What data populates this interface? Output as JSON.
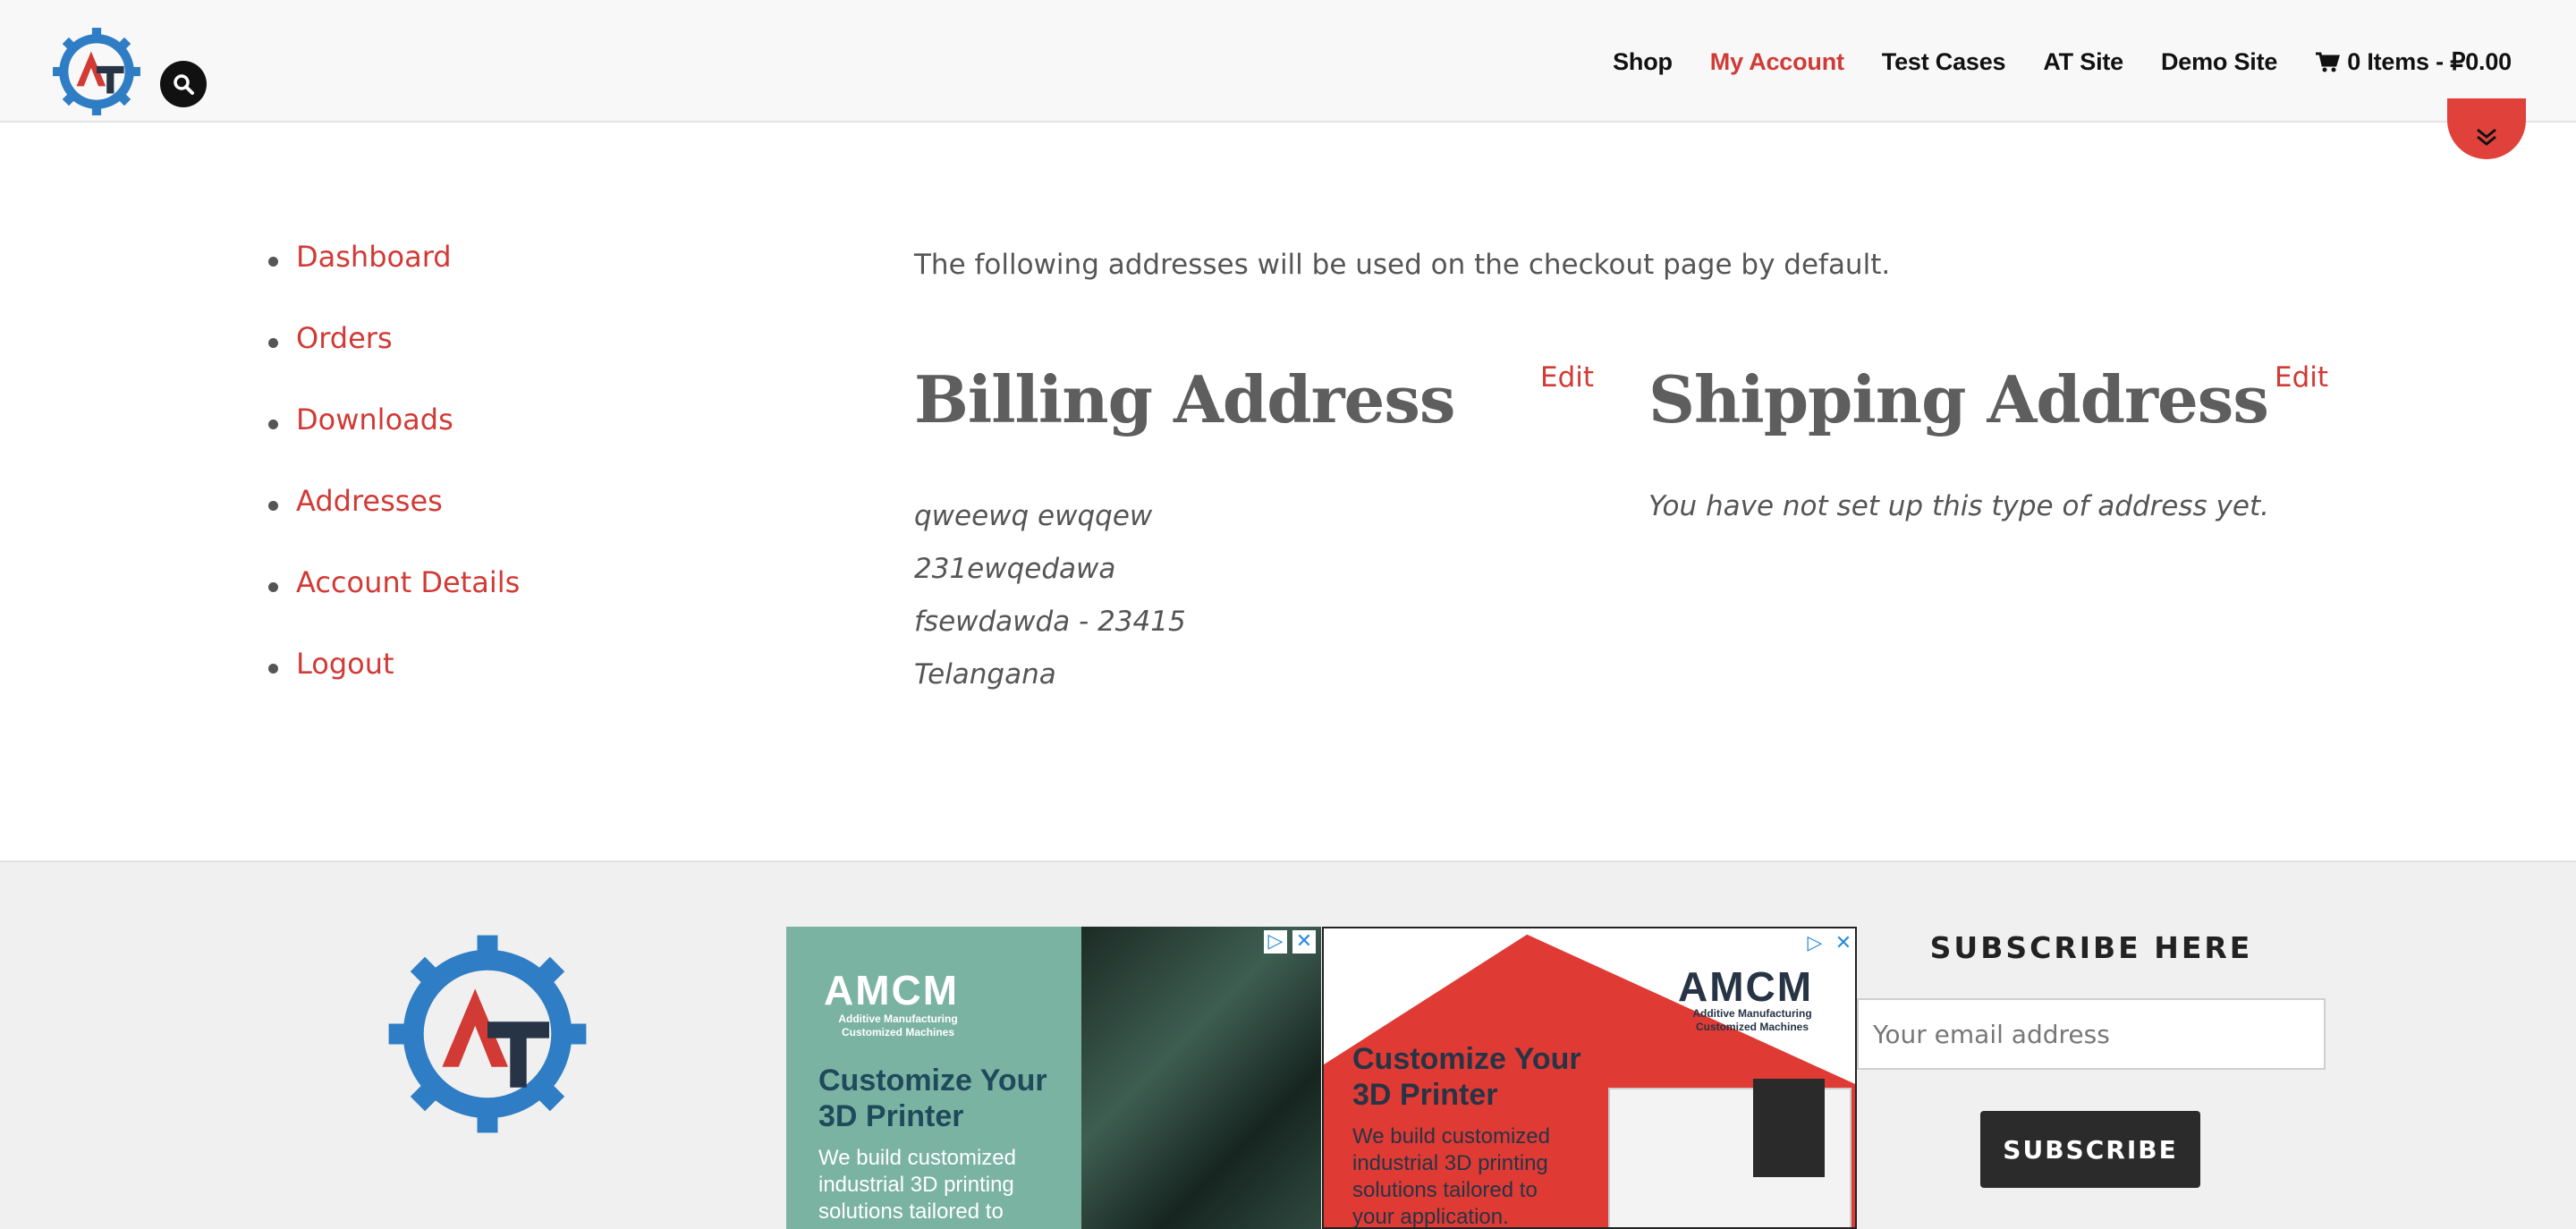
{
  "header": {
    "nav": [
      {
        "label": "Shop"
      },
      {
        "label": "My Account",
        "active": true
      },
      {
        "label": "Test Cases"
      },
      {
        "label": "AT Site"
      },
      {
        "label": "Demo Site"
      }
    ],
    "cart_label": "0 Items - ₽0.00",
    "logo_letters": "AT"
  },
  "sidebar": {
    "items": [
      {
        "label": "Dashboard"
      },
      {
        "label": "Orders"
      },
      {
        "label": "Downloads"
      },
      {
        "label": "Addresses"
      },
      {
        "label": "Account Details"
      },
      {
        "label": "Logout"
      }
    ]
  },
  "main": {
    "intro": "The following addresses will be used on the checkout page by default.",
    "billing": {
      "title": "Billing Address",
      "edit_label": "Edit",
      "lines": [
        "qweewq ewqqew",
        "231ewqedawa",
        "fsewdawda - 23415",
        "Telangana"
      ]
    },
    "shipping": {
      "title": "Shipping Address",
      "edit_label": "Edit",
      "empty_text": "You have not set up this type of address yet."
    }
  },
  "footer": {
    "ads": [
      {
        "brand": "AMCM",
        "subtitle": "Additive Manufacturing\nCustomized Machines",
        "headline": "Customize Your\n3D Printer",
        "body": "We build customized\nindustrial 3D printing\nsolutions tailored to"
      },
      {
        "brand": "AMCM",
        "subtitle": "Additive Manufacturing\nCustomized Machines",
        "headline": "Customize Your\n3D Printer",
        "body": "We build customized\nindustrial 3D printing\nsolutions tailored to\nyour application."
      }
    ],
    "subscribe": {
      "title": "SUBSCRIBE HERE",
      "placeholder": "Your email address",
      "button": "SUBSCRIBE"
    }
  },
  "colors": {
    "accent": "#d13a35",
    "logo_blue": "#2f7dc4",
    "logo_dark": "#263445",
    "text": "#555555"
  }
}
